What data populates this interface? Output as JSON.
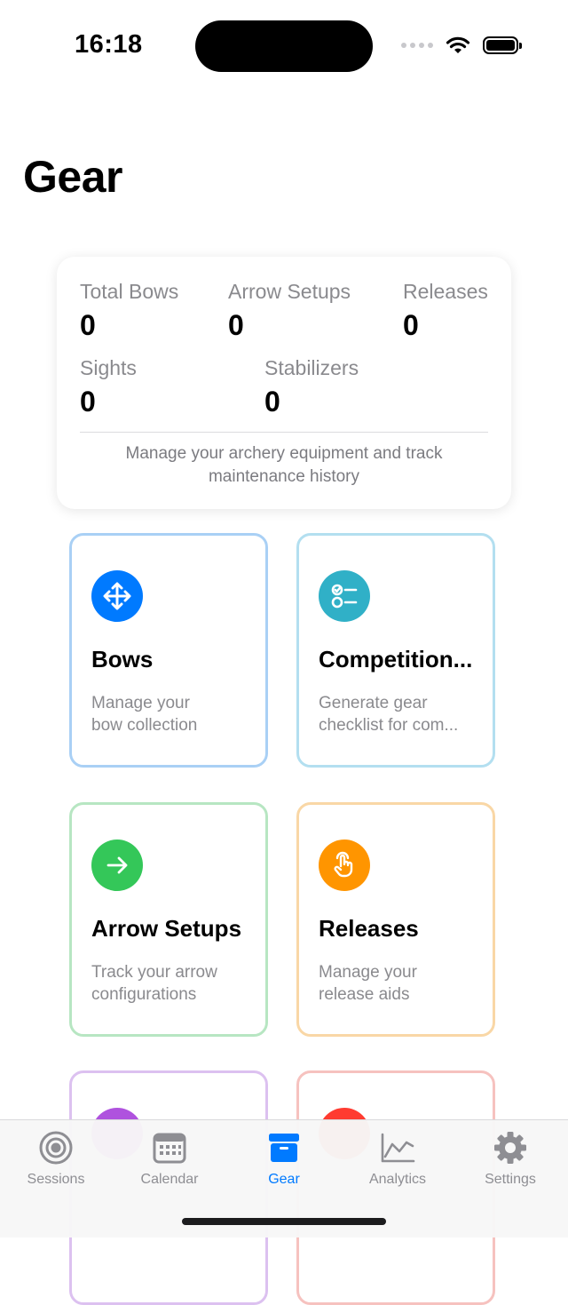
{
  "status": {
    "time": "16:18"
  },
  "page": {
    "title": "Gear"
  },
  "summary": {
    "stats": [
      {
        "label": "Total Bows",
        "value": "0"
      },
      {
        "label": "Arrow Setups",
        "value": "0"
      },
      {
        "label": "Releases",
        "value": "0"
      },
      {
        "label": "Sights",
        "value": "0"
      },
      {
        "label": "Stabilizers",
        "value": "0"
      }
    ],
    "description": "Manage your archery equipment and track maintenance history"
  },
  "tiles": [
    {
      "title": "Bows",
      "line1": "Manage your",
      "line2": "bow collection",
      "icon": "move-arrows-icon",
      "color": "#007aff",
      "border": "#a9d0f5"
    },
    {
      "title": "Competition...",
      "line1": "Generate gear",
      "line2": "checklist for com...",
      "icon": "checklist-icon",
      "color": "#30b0c7",
      "border": "#b3dff0"
    },
    {
      "title": "Arrow Setups",
      "line1": "Track your arrow",
      "line2": "configurations",
      "icon": "arrow-right-icon",
      "color": "#34c759",
      "border": "#b7e6c2"
    },
    {
      "title": "Releases",
      "line1": "Manage your",
      "line2": "release aids",
      "icon": "hand-tap-icon",
      "color": "#ff9500",
      "border": "#f9d7a6"
    },
    {
      "color": "#af52de",
      "border": "#dcc1f0"
    },
    {
      "color": "#ff3b30",
      "border": "#f6c2bf"
    }
  ],
  "tabbar": {
    "tabs": [
      {
        "label": "Sessions",
        "icon": "target-icon"
      },
      {
        "label": "Calendar",
        "icon": "calendar-icon"
      },
      {
        "label": "Gear",
        "icon": "archive-box-icon",
        "active": true
      },
      {
        "label": "Analytics",
        "icon": "line-chart-icon"
      },
      {
        "label": "Settings",
        "icon": "gear-icon"
      }
    ],
    "active_color": "#007aff",
    "inactive_color": "#8e8e93"
  }
}
